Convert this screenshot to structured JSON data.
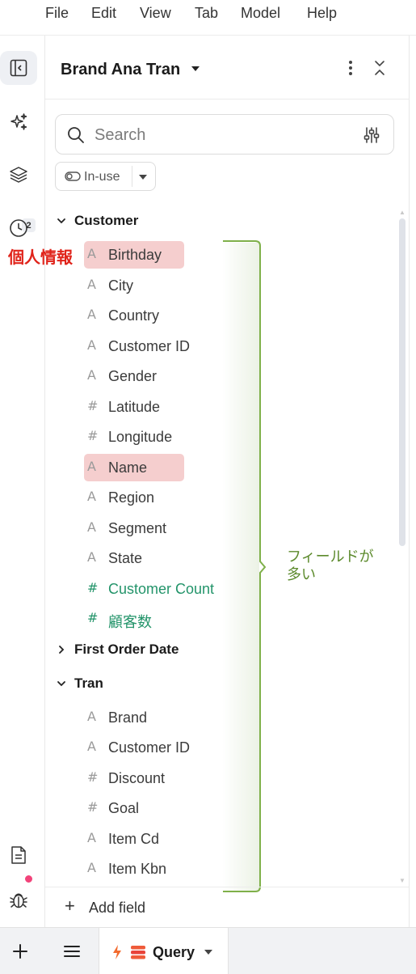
{
  "menu": [
    "File",
    "Edit",
    "View",
    "Tab",
    "Model",
    "Help"
  ],
  "rail": {
    "icons": [
      "panel-toggle-icon",
      "sparkle-icon",
      "layers-icon",
      "history-icon",
      "document-icon",
      "bug-icon"
    ],
    "layers_badge": "2",
    "notification_color": "#f2437a"
  },
  "panel": {
    "title": "Brand Ana Tran"
  },
  "search": {
    "placeholder": "Search"
  },
  "filter": {
    "label": "In-use"
  },
  "groups": [
    {
      "label": "Customer",
      "expanded": true
    },
    {
      "label": "First Order Date",
      "expanded": false
    },
    {
      "label": "Tran",
      "expanded": true
    }
  ],
  "customer_fields": [
    {
      "label": "Birthday",
      "type": "string"
    },
    {
      "label": "City",
      "type": "string"
    },
    {
      "label": "Country",
      "type": "string"
    },
    {
      "label": "Customer ID",
      "type": "string"
    },
    {
      "label": "Gender",
      "type": "string"
    },
    {
      "label": "Latitude",
      "type": "number"
    },
    {
      "label": "Longitude",
      "type": "number"
    },
    {
      "label": "Name",
      "type": "string"
    },
    {
      "label": "Region",
      "type": "string"
    },
    {
      "label": "Segment",
      "type": "string"
    },
    {
      "label": "State",
      "type": "string"
    },
    {
      "label": "Customer Count",
      "type": "measure"
    },
    {
      "label": "顧客数",
      "type": "measure"
    }
  ],
  "tran_fields": [
    {
      "label": "Brand",
      "type": "string"
    },
    {
      "label": "Customer ID",
      "type": "string"
    },
    {
      "label": "Discount",
      "type": "number"
    },
    {
      "label": "Goal",
      "type": "number"
    },
    {
      "label": "Item Cd",
      "type": "string"
    },
    {
      "label": "Item Kbn",
      "type": "string"
    }
  ],
  "add_field": {
    "label": "Add field"
  },
  "bottom": {
    "query_tab": "Query"
  },
  "annotations": {
    "pii": "個人情報",
    "many_fields": "フィールドが多い",
    "pii_color": "#e0241b",
    "note_color": "#5c8a2c",
    "highlight_color": "#f4cbcb"
  },
  "colors": {
    "measure": "#23946a",
    "brace": "#7fb04a"
  }
}
